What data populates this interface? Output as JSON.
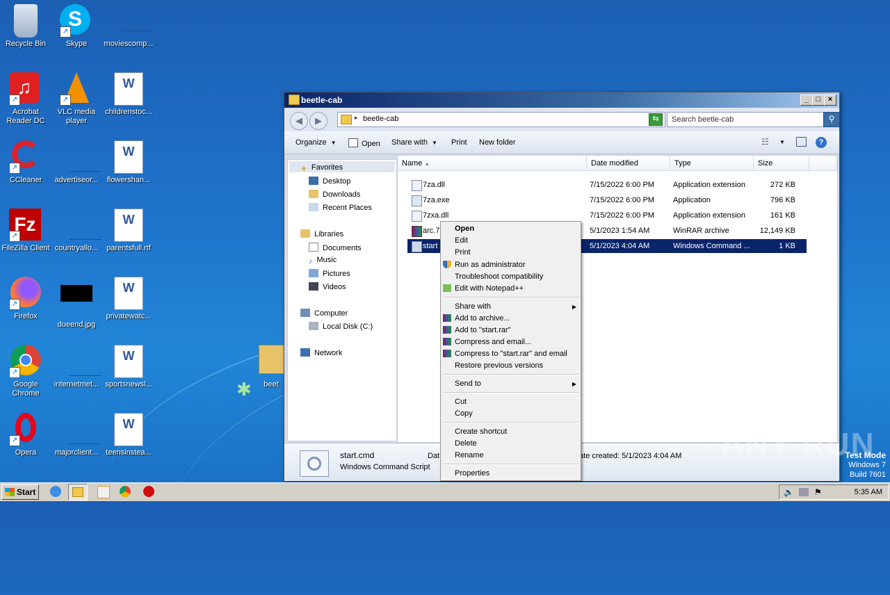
{
  "desktop": {
    "icons": [
      {
        "label": "Recycle Bin"
      },
      {
        "label": "Skype"
      },
      {
        "label": "moviescomp..."
      },
      {
        "label": "Acrobat Reader DC"
      },
      {
        "label": "VLC media player"
      },
      {
        "label": "childrenstoc..."
      },
      {
        "label": "CCleaner"
      },
      {
        "label": "advertiseor..."
      },
      {
        "label": "flowershan..."
      },
      {
        "label": "FileZilla Client"
      },
      {
        "label": "countryallo..."
      },
      {
        "label": "parentsfull.rtf"
      },
      {
        "label": "Firefox"
      },
      {
        "label": "dueend.jpg"
      },
      {
        "label": "privatewatc..."
      },
      {
        "label": "Google Chrome"
      },
      {
        "label": "internetmet..."
      },
      {
        "label": "sportsnewsl..."
      },
      {
        "label": "Opera"
      },
      {
        "label": "majorclient..."
      },
      {
        "label": "teensinstea..."
      },
      {
        "label": "beet"
      }
    ]
  },
  "window": {
    "title": "beetle-cab",
    "address": "beetle-cab",
    "search_placeholder": "Search beetle-cab",
    "commands": {
      "organize": "Organize",
      "open": "Open",
      "share_with": "Share with",
      "print": "Print",
      "new_folder": "New folder"
    },
    "nav": {
      "favorites": "Favorites",
      "desktop": "Desktop",
      "downloads": "Downloads",
      "recent": "Recent Places",
      "libraries": "Libraries",
      "documents": "Documents",
      "music": "Music",
      "pictures": "Pictures",
      "videos": "Videos",
      "computer": "Computer",
      "localdisk": "Local Disk (C:)",
      "network": "Network"
    },
    "columns": {
      "name": "Name",
      "date": "Date modified",
      "type": "Type",
      "size": "Size"
    },
    "files": [
      {
        "name": "7za.dll",
        "date": "7/15/2022 6:00 PM",
        "type": "Application extension",
        "size": "272 KB"
      },
      {
        "name": "7za.exe",
        "date": "7/15/2022 6:00 PM",
        "type": "Application",
        "size": "796 KB"
      },
      {
        "name": "7zxa.dll",
        "date": "7/15/2022 6:00 PM",
        "type": "Application extension",
        "size": "161 KB"
      },
      {
        "name": "arc.7",
        "date": "5/1/2023 1:54 AM",
        "type": "WinRAR archive",
        "size": "12,149 KB"
      },
      {
        "name": "start",
        "date": "5/1/2023 4:04 AM",
        "type": "Windows Command ...",
        "size": "1 KB"
      }
    ],
    "details": {
      "filename": "start.cmd",
      "filetype": "Windows Command Script",
      "date_label": "Dat",
      "created": "ate created: 5/1/2023 4:04 AM"
    }
  },
  "context_menu": {
    "items": [
      "Open",
      "Edit",
      "Print",
      "Run as administrator",
      "Troubleshoot compatibility",
      "Edit with Notepad++",
      "Share with",
      "Add to archive...",
      "Add to \"start.rar\"",
      "Compress and email...",
      "Compress to \"start.rar\" and email",
      "Restore previous versions",
      "Send to",
      "Cut",
      "Copy",
      "Create shortcut",
      "Delete",
      "Rename",
      "Properties"
    ]
  },
  "taskbar": {
    "start": "Start",
    "clock": "5:35 AM"
  },
  "watermark": "ANY RUN",
  "os_info": {
    "line1": "Test Mode",
    "line2": "Windows 7",
    "line3": "Build 7601"
  }
}
